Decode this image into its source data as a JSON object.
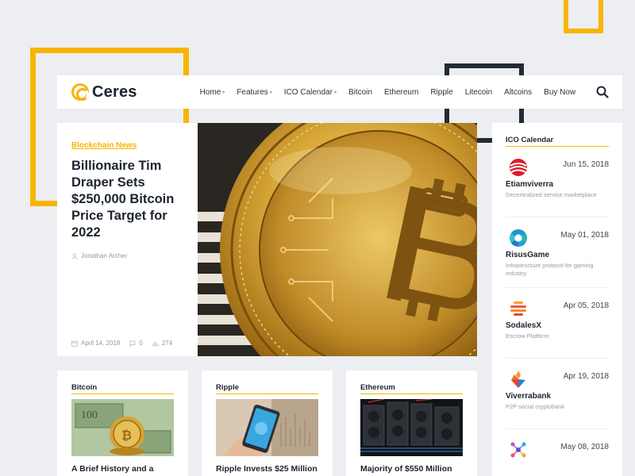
{
  "brand": {
    "name": "Ceres"
  },
  "nav": {
    "items": [
      {
        "label": "Home",
        "has_dropdown": true
      },
      {
        "label": "Features",
        "has_dropdown": true
      },
      {
        "label": "ICO Calendar",
        "has_dropdown": true
      },
      {
        "label": "Bitcoin",
        "has_dropdown": false
      },
      {
        "label": "Ethereum",
        "has_dropdown": false
      },
      {
        "label": "Ripple",
        "has_dropdown": false
      },
      {
        "label": "Litecoin",
        "has_dropdown": false
      },
      {
        "label": "Altcoins",
        "has_dropdown": false
      },
      {
        "label": "Buy Now",
        "has_dropdown": false
      }
    ],
    "search_icon": "search-icon"
  },
  "featured": {
    "category": "Blockchain News",
    "title": "Billionaire Tim Draper Sets $250,000 Bitcoin Price Target for 2022",
    "author": "Jonathan Archer",
    "date": "April 14, 2018",
    "comments": "0",
    "views": "274"
  },
  "sidebar": {
    "title": "ICO Calendar",
    "items": [
      {
        "name": "Etiamviverra",
        "date": "Jun 15, 2018",
        "description": "Decentralized service marketplace"
      },
      {
        "name": "RisusGame",
        "date": "May 01, 2018",
        "description": "Infrastructure protocol for gaming industry"
      },
      {
        "name": "SodalesX",
        "date": "Apr 05, 2018",
        "description": "Escrow Platform"
      },
      {
        "name": "Viverrabank",
        "date": "Apr 19, 2018",
        "description": "P2P social cryptobank"
      },
      {
        "name": "",
        "date": "May 08, 2018",
        "description": ""
      }
    ]
  },
  "cards": [
    {
      "category": "Bitcoin",
      "title": "A Brief History and a"
    },
    {
      "category": "Ripple",
      "title": "Ripple Invests $25 Million"
    },
    {
      "category": "Ethereum",
      "title": "Majority of $550 Million"
    }
  ],
  "colors": {
    "accent": "#f7b500",
    "dark": "#1c2430",
    "background": "#eceef2"
  }
}
